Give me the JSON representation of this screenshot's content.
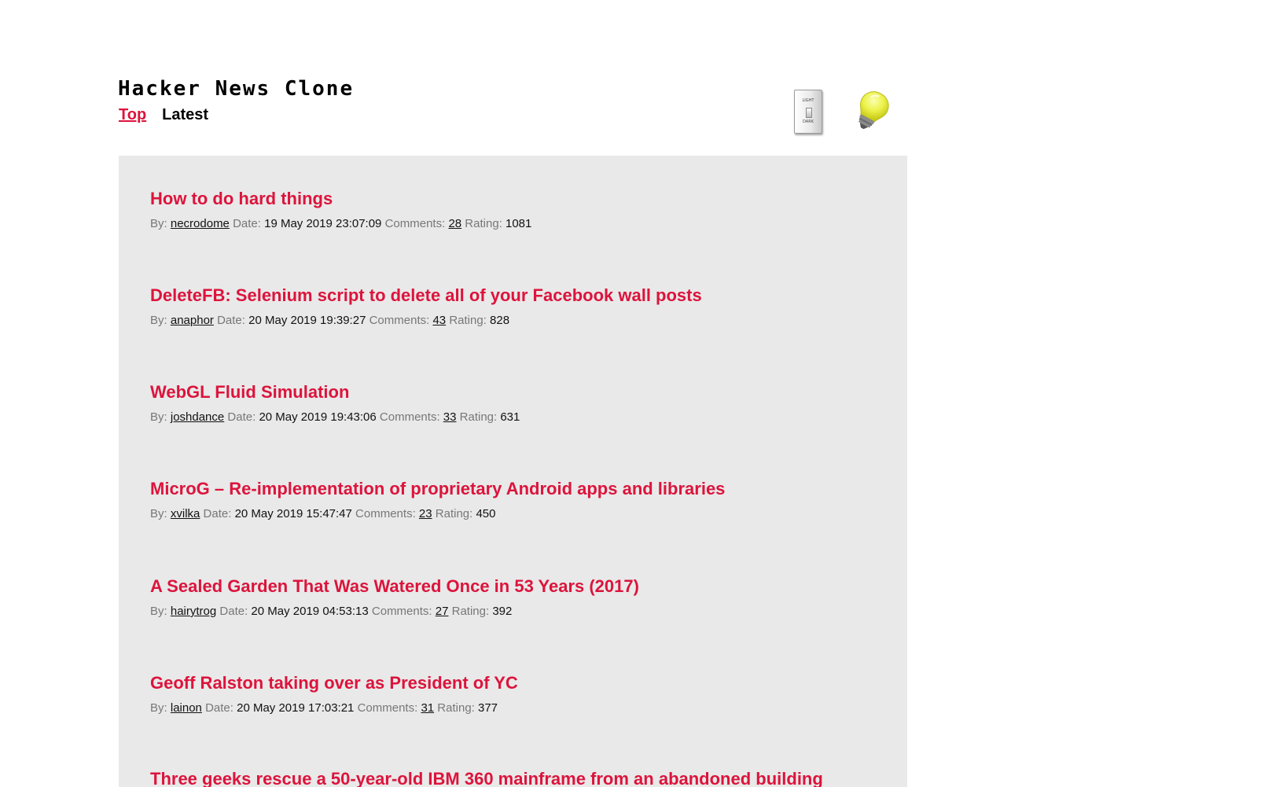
{
  "header": {
    "title": "Hacker News Clone",
    "nav": [
      {
        "label": "Top",
        "active": true
      },
      {
        "label": "Latest",
        "active": false
      }
    ],
    "theme_switch": {
      "top_label": "LIGHT",
      "bottom_label": "DARK"
    }
  },
  "meta_labels": {
    "by": "By:",
    "date": "Date:",
    "comments": "Comments:",
    "rating": "Rating:"
  },
  "stories": [
    {
      "title": "How to do hard things",
      "author": "necrodome",
      "date": "19 May 2019 23:07:09",
      "comments": "28",
      "rating": "1081"
    },
    {
      "title": "DeleteFB: Selenium script to delete all of your Facebook wall posts",
      "author": "anaphor",
      "date": "20 May 2019 19:39:27",
      "comments": "43",
      "rating": "828"
    },
    {
      "title": "WebGL Fluid Simulation",
      "author": "joshdance",
      "date": "20 May 2019 19:43:06",
      "comments": "33",
      "rating": "631"
    },
    {
      "title": "MicroG – Re-implementation of proprietary Android apps and libraries",
      "author": "xvilka",
      "date": "20 May 2019 15:47:47",
      "comments": "23",
      "rating": "450"
    },
    {
      "title": "A Sealed Garden That Was Watered Once in 53 Years (2017)",
      "author": "hairytrog",
      "date": "20 May 2019 04:53:13",
      "comments": "27",
      "rating": "392"
    },
    {
      "title": "Geoff Ralston taking over as President of YC",
      "author": "lainon",
      "date": "20 May 2019 17:03:21",
      "comments": "31",
      "rating": "377"
    },
    {
      "title": "Three geeks rescue a 50-year-old IBM 360 mainframe from an abandoned building"
    }
  ],
  "colors": {
    "accent": "#dc143c",
    "panel_bg": "#e9e9e9",
    "label_gray": "#777777"
  }
}
